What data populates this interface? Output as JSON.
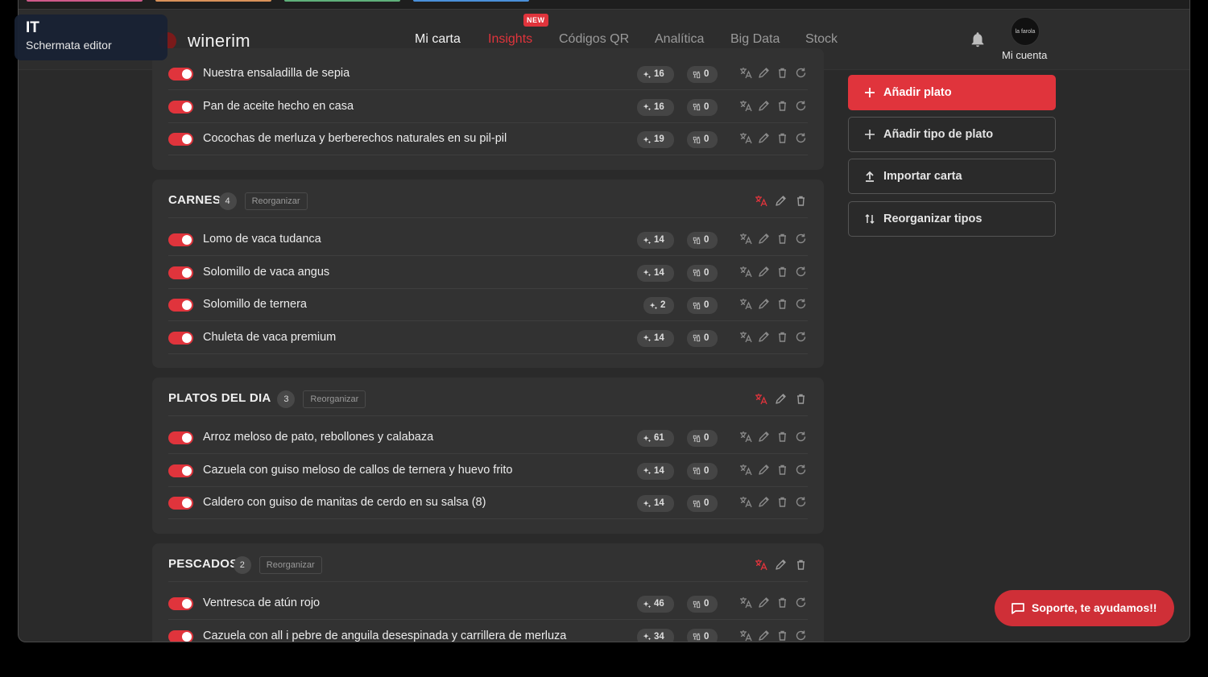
{
  "overlay": {
    "language": "IT",
    "label": "Schermata editor"
  },
  "brand": {
    "name": "winerim",
    "accent": "#e0343c"
  },
  "nav": {
    "items": [
      {
        "label": "Mi carta"
      },
      {
        "label": "Insights"
      },
      {
        "label": "Códigos QR"
      },
      {
        "label": "Analítica"
      },
      {
        "label": "Big Data"
      },
      {
        "label": "Stock"
      }
    ],
    "new_badge": "NEW",
    "active": "Mi carta"
  },
  "account": {
    "label": "Mi cuenta",
    "avatar_text": "la farola"
  },
  "sidebar": {
    "add_dish": "Añadir plato",
    "add_type": "Añadir tipo de plato",
    "import": "Importar carta",
    "reorder_types": "Reorganizar tipos"
  },
  "support": {
    "label": "Soporte, te ayudamos!!"
  },
  "sections": [
    {
      "dishes": [
        {
          "name": "Nuestra ensaladilla de sepia",
          "ai": "16",
          "wine": "0"
        },
        {
          "name": "Pan de aceite hecho en casa",
          "ai": "16",
          "wine": "0"
        },
        {
          "name": "Cocochas de merluza y berberechos naturales en su pil-pil",
          "ai": "19",
          "wine": "0"
        }
      ]
    },
    {
      "name": "CARNES",
      "count": "4",
      "reorder": "Reorganizar",
      "dishes": [
        {
          "name": "Lomo de vaca tudanca",
          "ai": "14",
          "wine": "0"
        },
        {
          "name": "Solomillo de vaca angus",
          "ai": "14",
          "wine": "0"
        },
        {
          "name": "Solomillo de ternera",
          "ai": "2",
          "wine": "0"
        },
        {
          "name": "Chuleta de vaca premium",
          "ai": "14",
          "wine": "0"
        }
      ]
    },
    {
      "name": "PLATOS DEL DIA",
      "count": "3",
      "reorder": "Reorganizar",
      "dishes": [
        {
          "name": "Arroz meloso de pato, rebollones y calabaza",
          "ai": "61",
          "wine": "0"
        },
        {
          "name": "Cazuela con guiso meloso de callos de ternera y huevo frito",
          "ai": "14",
          "wine": "0"
        },
        {
          "name": "Caldero con guiso de manitas de cerdo en su salsa (8)",
          "ai": "14",
          "wine": "0"
        }
      ]
    },
    {
      "name": "PESCADOS",
      "count": "2",
      "reorder": "Reorganizar",
      "dishes": [
        {
          "name": "Ventresca de atún rojo",
          "ai": "46",
          "wine": "0"
        },
        {
          "name": "Cazuela con all i pebre de anguila desespinada y carrillera de merluza",
          "ai": "34",
          "wine": "0"
        }
      ]
    }
  ]
}
